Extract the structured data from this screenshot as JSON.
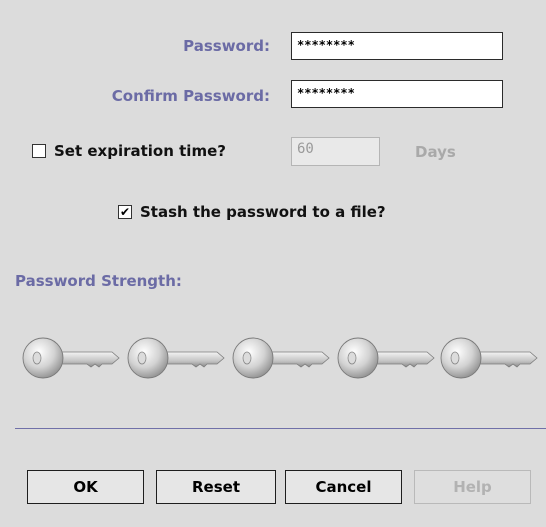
{
  "form": {
    "password_label": "Password:",
    "password_value": "********",
    "confirm_label": "Confirm Password:",
    "confirm_value": "********",
    "expiration": {
      "label": "Set expiration time?",
      "checked": false,
      "value": "60",
      "unit": "Days"
    },
    "stash": {
      "label": "Stash the password to a file?",
      "checked": true,
      "check_glyph": "✔"
    }
  },
  "strength": {
    "label": "Password Strength:",
    "keys": [
      {
        "icon": "key-icon"
      },
      {
        "icon": "key-icon"
      },
      {
        "icon": "key-icon"
      },
      {
        "icon": "key-icon"
      },
      {
        "icon": "key-icon"
      }
    ],
    "filled_count": 0,
    "total_count": 5
  },
  "buttons": {
    "ok": "OK",
    "reset": "Reset",
    "cancel": "Cancel",
    "help": "Help"
  },
  "colors": {
    "label_accent": "#6b6ba5",
    "background": "#dcdcdc",
    "disabled_text": "#a9a9a9"
  }
}
